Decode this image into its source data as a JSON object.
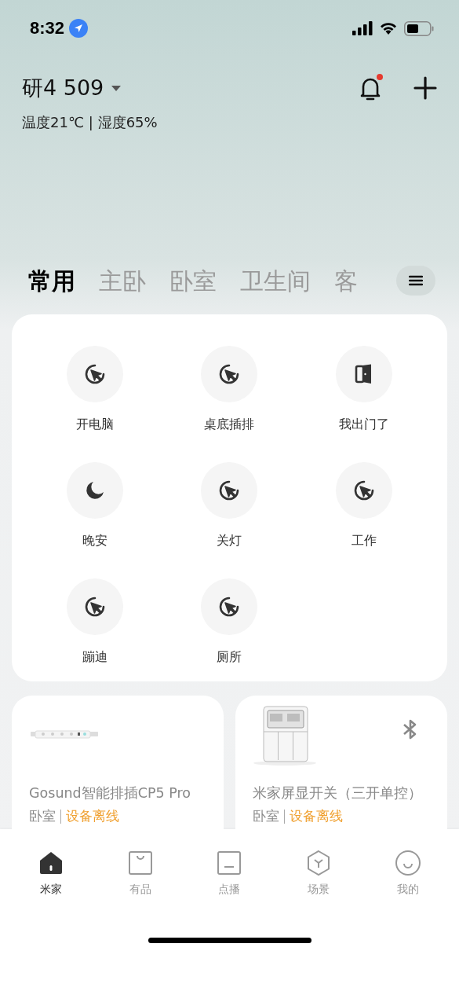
{
  "status_bar": {
    "time": "8:32"
  },
  "header": {
    "home": "研4 509",
    "climate": "温度21℃ | 湿度65%",
    "has_notification": true
  },
  "tabs": [
    {
      "label": "常用",
      "selected": true
    },
    {
      "label": "主卧",
      "selected": false
    },
    {
      "label": "卧室",
      "selected": false
    },
    {
      "label": "卫生间",
      "selected": false
    },
    {
      "label": "客",
      "selected": false
    }
  ],
  "scenes": [
    {
      "label": "开电脑",
      "kind": "cursor"
    },
    {
      "label": "桌底插排",
      "kind": "cursor"
    },
    {
      "label": "我出门了",
      "kind": "door"
    },
    {
      "label": "晚安",
      "kind": "moon"
    },
    {
      "label": "关灯",
      "kind": "cursor"
    },
    {
      "label": "工作",
      "kind": "cursor"
    },
    {
      "label": "蹦迪",
      "kind": "cursor"
    },
    {
      "label": "厕所",
      "kind": "cursor"
    }
  ],
  "devices": [
    {
      "name": "Gosund智能排插CP5 Pro",
      "room": "卧室",
      "status": "设备离线",
      "bluetooth": false
    },
    {
      "name": "米家屏显开关（三开单控）",
      "room": "卧室",
      "status": "设备离线",
      "bluetooth": true
    }
  ],
  "nav": [
    {
      "label": "米家",
      "kind": "home",
      "selected": true
    },
    {
      "label": "有品",
      "kind": "bag",
      "selected": false
    },
    {
      "label": "点播",
      "kind": "screen",
      "selected": false
    },
    {
      "label": "场景",
      "kind": "cube",
      "selected": false
    },
    {
      "label": "我的",
      "kind": "smile",
      "selected": false
    }
  ]
}
